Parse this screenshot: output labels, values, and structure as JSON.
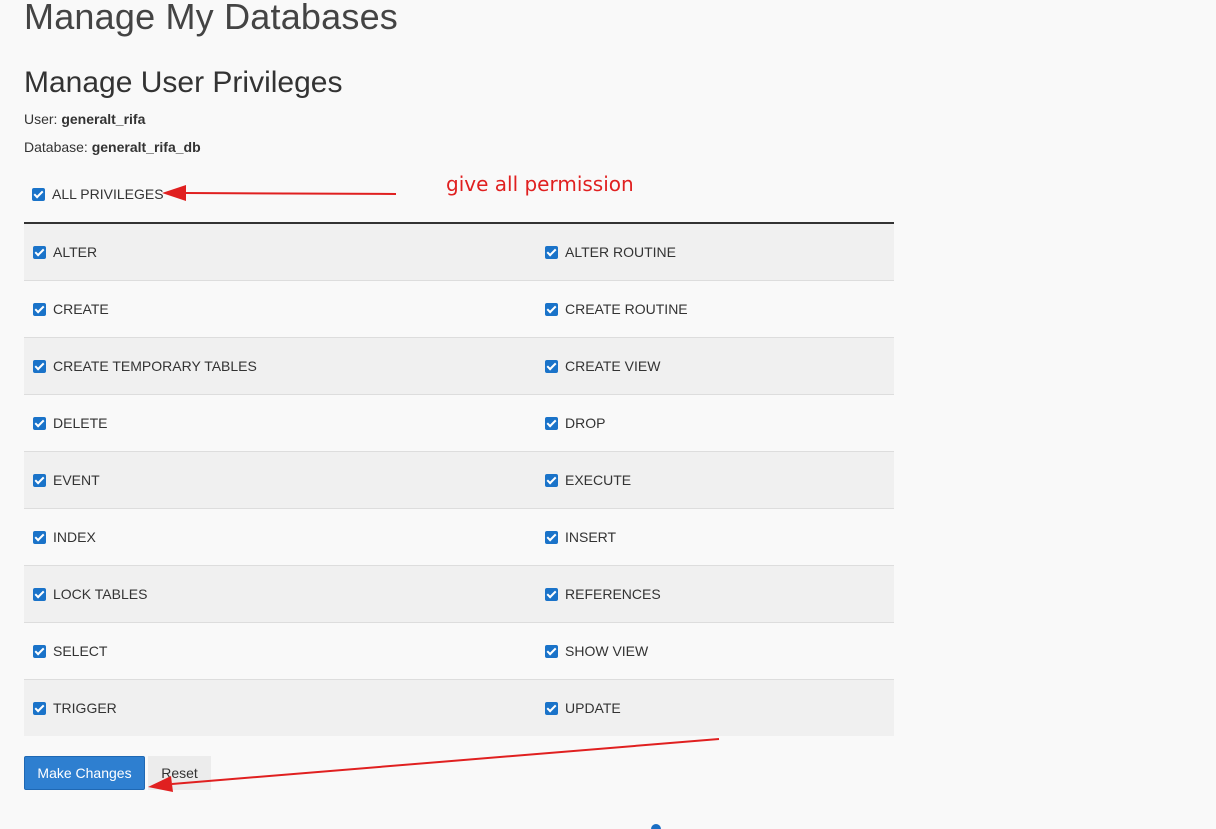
{
  "page": {
    "title": "Manage My Databases",
    "section_title": "Manage User Privileges"
  },
  "user": {
    "label": "User:",
    "value": "generalt_rifa"
  },
  "database": {
    "label": "Database:",
    "value": "generalt_rifa_db"
  },
  "all_privileges": {
    "label": "ALL PRIVILEGES",
    "checked": true
  },
  "annotation": {
    "text": "give all permission",
    "color": "#e02020"
  },
  "privileges": [
    {
      "left": "ALTER",
      "right": "ALTER ROUTINE"
    },
    {
      "left": "CREATE",
      "right": "CREATE ROUTINE"
    },
    {
      "left": "CREATE TEMPORARY TABLES",
      "right": "CREATE VIEW"
    },
    {
      "left": "DELETE",
      "right": "DROP"
    },
    {
      "left": "EVENT",
      "right": "EXECUTE"
    },
    {
      "left": "INDEX",
      "right": "INSERT"
    },
    {
      "left": "LOCK TABLES",
      "right": "REFERENCES"
    },
    {
      "left": "SELECT",
      "right": "SHOW VIEW"
    },
    {
      "left": "TRIGGER",
      "right": "UPDATE"
    }
  ],
  "buttons": {
    "make_changes": "Make Changes",
    "reset": "Reset"
  },
  "colors": {
    "primary": "#2e7fd0",
    "checkbox": "#1a73c9",
    "arrow": "#e02020"
  }
}
